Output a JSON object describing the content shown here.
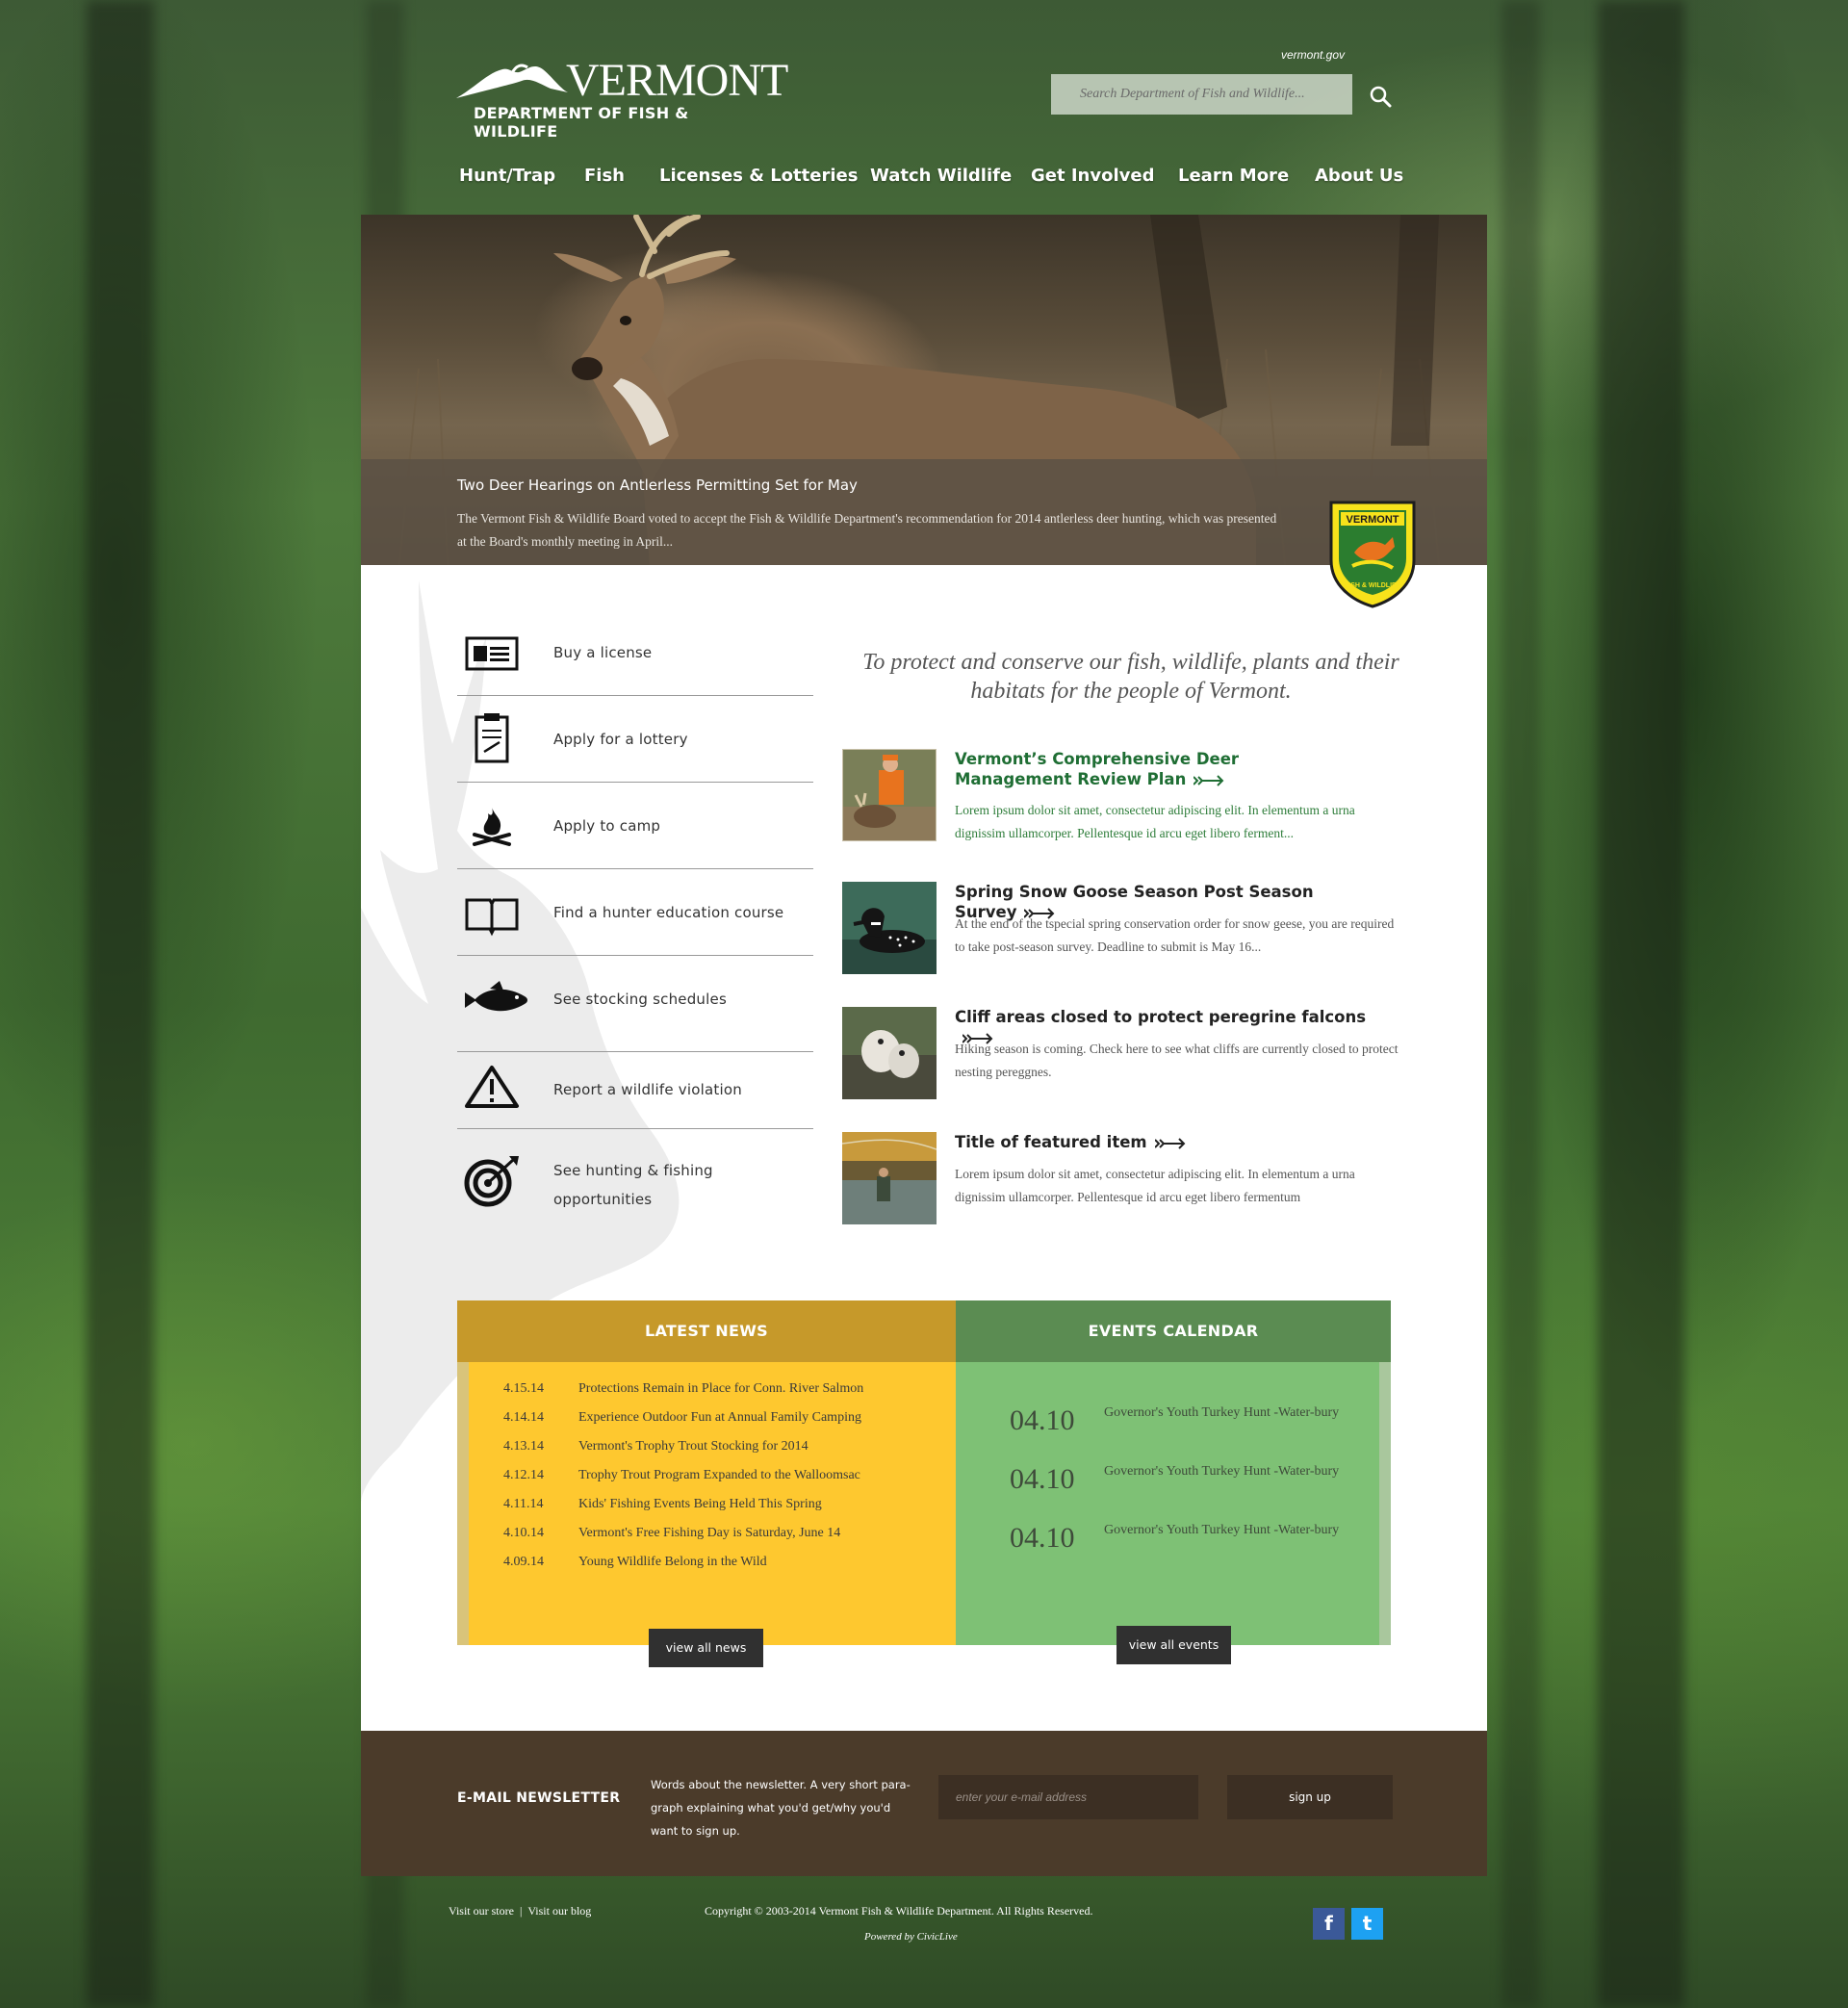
{
  "header": {
    "logo_word": "VERMONT",
    "logo_sub": "DEPARTMENT OF FISH & WILDLIFE",
    "gov_link": "vermont.gov",
    "search_placeholder": "Search Department of Fish and Wildlife..."
  },
  "nav": [
    "Hunt/Trap",
    "Fish",
    "Licenses & Lotteries",
    "Watch Wildlife",
    "Get Involved",
    "Learn More",
    "About Us"
  ],
  "hero": {
    "title": "Two Deer Hearings on Antlerless Permitting Set for May",
    "text": "The Vermont Fish & Wildlife Board voted to accept the Fish & Wildlife Department's recommendation for 2014 antlerless deer hunting, which was presented at the Board's monthly meeting in April...",
    "badge_top": "VERMONT",
    "badge_bottom": "FISH & WILDLIFE"
  },
  "quick_links": [
    {
      "label": "Buy a license",
      "icon": "license-card-icon"
    },
    {
      "label": "Apply for a lottery",
      "icon": "clipboard-icon"
    },
    {
      "label": "Apply to camp",
      "icon": "campfire-icon"
    },
    {
      "label": "Find a hunter education course",
      "icon": "open-book-icon"
    },
    {
      "label": "See stocking schedules",
      "icon": "fish-icon"
    },
    {
      "label": "Report a wildlife violation",
      "icon": "warning-icon"
    },
    {
      "label": "See hunting & fishing opportunities",
      "icon": "target-icon"
    }
  ],
  "mission": "To protect and conserve our fish, wildlife, plants and their habitats for the people of Vermont.",
  "features": [
    {
      "title": "Vermont’s Comprehensive Deer Management Review Plan",
      "text": "Lorem ipsum dolor sit amet, consectetur adipiscing elit. In elementum a urna dignissim ullamcorper. Pellentesque id arcu eget libero ferment...",
      "image": "hunter-with-deer"
    },
    {
      "title": "Spring Snow Goose Season Post Season Survey",
      "text": "At the end of the tspecial spring conservation order for snow geese, you are required to take post-season survey. Deadline to submit is May 16...",
      "image": "loon"
    },
    {
      "title": "Cliff areas closed to protect peregrine falcons",
      "text": "Hiking season is coming. Check here to see what cliffs are currently closed to protect nesting pereggnes.",
      "image": "falcon-chicks"
    },
    {
      "title": "Title of featured item",
      "text": "Lorem ipsum dolor sit amet, consectetur adipiscing elit. In elementum a urna dignissim ullamcorper. Pellentesque id arcu eget libero fermentum",
      "image": "fly-fishing"
    }
  ],
  "news": {
    "heading": "LATEST NEWS",
    "items": [
      {
        "date": "4.15.14",
        "title": "Protections Remain in Place for Conn. River Salmon"
      },
      {
        "date": "4.14.14",
        "title": "Experience Outdoor Fun at Annual Family Camping"
      },
      {
        "date": "4.13.14",
        "title": "Vermont's Trophy Trout Stocking for 2014"
      },
      {
        "date": "4.12.14",
        "title": "Trophy Trout Program Expanded to the Walloomsac"
      },
      {
        "date": "4.11.14",
        "title": "Kids' Fishing Events Being Held This Spring"
      },
      {
        "date": "4.10.14",
        "title": "Vermont's Free Fishing Day is Saturday, June 14"
      },
      {
        "date": "4.09.14",
        "title": "Young Wildlife Belong in the Wild"
      }
    ],
    "button": "view all news"
  },
  "events": {
    "heading": "EVENTS CALENDAR",
    "items": [
      {
        "date": "04.10",
        "title": "Governor's Youth Turkey Hunt -Water-bury"
      },
      {
        "date": "04.10",
        "title": "Governor's Youth Turkey Hunt -Water-bury"
      },
      {
        "date": "04.10",
        "title": "Governor's Youth Turkey Hunt -Water-bury"
      }
    ],
    "button": "view all events"
  },
  "newsletter": {
    "label": "E-MAIL NEWSLETTER",
    "text": "Words about the newsletter. A very short para-graph explaining what you'd get/why you'd want to sign up.",
    "placeholder": "enter your e-mail address",
    "button": "sign up"
  },
  "footer": {
    "store": "Visit our store",
    "separator": "|",
    "blog": "Visit our blog",
    "copyright": "Copyright © 2003-2014 Vermont Fish & Wildlife Department. All Rights Reserved.",
    "powered": "Powered by CivicLive",
    "social": [
      {
        "icon": "facebook-icon",
        "glyph": "f",
        "color": "#3b5998"
      },
      {
        "icon": "twitter-icon",
        "glyph": "t",
        "color": "#1da1f2"
      }
    ]
  },
  "colors": {
    "news_header": "#c6992a",
    "news_body": "#fec82f",
    "events_header": "#5b8c52",
    "events_body": "#7ec175",
    "newsletter_bg": "#4b3b2a",
    "feature_green": "#1f6e34"
  }
}
